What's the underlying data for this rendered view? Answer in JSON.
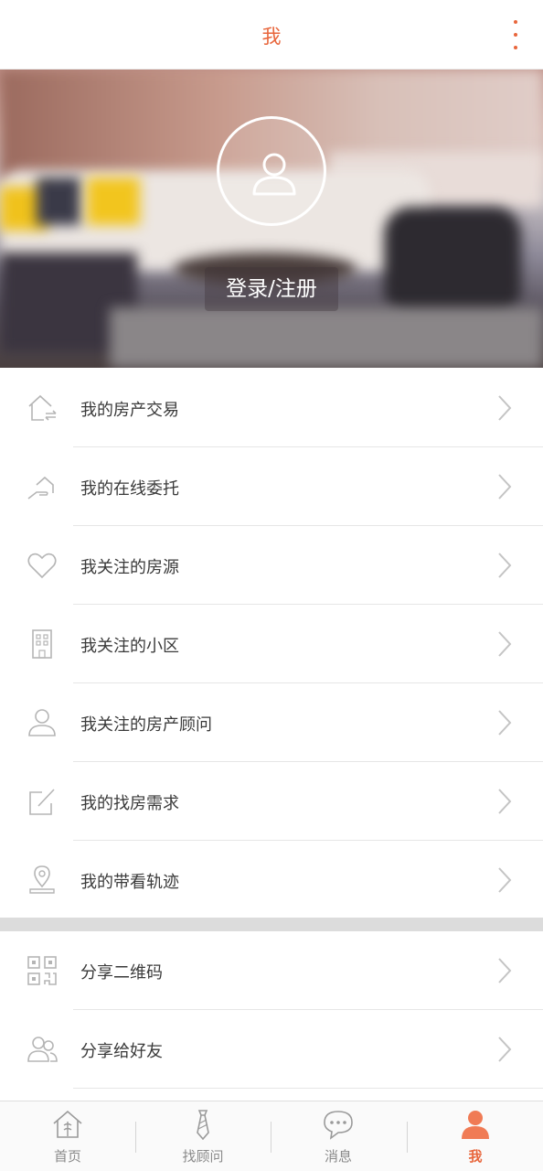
{
  "header": {
    "title": "我",
    "more_icon": "more-vertical-icon"
  },
  "banner": {
    "avatar_icon": "user-avatar-icon",
    "login_label": "登录/注册"
  },
  "menu": [
    {
      "label": "我的房产交易",
      "icon": "house-transaction-icon"
    },
    {
      "label": "我的在线委托",
      "icon": "hand-house-icon"
    },
    {
      "label": "我关注的房源",
      "icon": "heart-icon"
    },
    {
      "label": "我关注的小区",
      "icon": "building-icon"
    },
    {
      "label": "我关注的房产顾问",
      "icon": "person-icon"
    },
    {
      "label": "我的找房需求",
      "icon": "edit-note-icon"
    },
    {
      "label": "我的带看轨迹",
      "icon": "location-pin-icon"
    }
  ],
  "share": [
    {
      "label": "分享二维码",
      "icon": "qr-code-icon"
    },
    {
      "label": "分享给好友",
      "icon": "friends-icon"
    }
  ],
  "tabs": [
    {
      "label": "首页",
      "icon": "home-icon",
      "active": false
    },
    {
      "label": "找顾问",
      "icon": "tie-icon",
      "active": false
    },
    {
      "label": "消息",
      "icon": "chat-bubble-icon",
      "active": false
    },
    {
      "label": "我",
      "icon": "person-filled-icon",
      "active": true
    }
  ],
  "colors": {
    "accent": "#e8663c",
    "text": "#3a3a3a",
    "icon_gray": "#b5b5b5",
    "divider": "#e6e6e6"
  }
}
